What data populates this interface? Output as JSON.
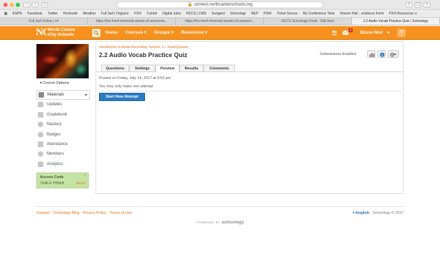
{
  "browser": {
    "url": "connect.northcantonschools.org",
    "bookmarks": [
      "ESPN",
      "Facebook",
      "Twitter",
      "Hootsuite",
      "Weather",
      "Full Sail | Orgsync",
      "FSO",
      "Tumblr",
      "Digital Juice",
      "NCCS | CMS",
      "Sungard",
      "Schoology",
      "MLP",
      "PSW",
      "Ticket Source",
      "My Conference Time",
      "Hoover Hall ...endance Form",
      "FSO-Resources ∨"
    ],
    "tabs": [
      {
        "label": "Full Sail Online | v4",
        "active": false
      },
      {
        "label": "https://fso-lms4-immortal-assets.s3.amazona...",
        "active": false
      },
      {
        "label": "https://fso-lms4-immortal-assets.s3.amazon...",
        "active": false
      },
      {
        "label": "NCCS Schoology Kiosk - Edit Item",
        "active": false
      },
      {
        "label": "2.2 Audio Vocab Practice Quiz | Schoology",
        "active": true
      }
    ]
  },
  "header": {
    "logo_initials": "NC",
    "logo_line1": "North Canton",
    "logo_line2": "City Schools",
    "nav": [
      "Home",
      "Courses ▾",
      "Groups ▾",
      "Resources ▾"
    ],
    "message_count": "1",
    "user_name": "Bruce Nist",
    "help_label": "?"
  },
  "sidebar": {
    "course_options": "▾ Course Options",
    "items": [
      {
        "label": "Materials",
        "icon": "materials-icon"
      },
      {
        "label": "Updates",
        "icon": "updates-icon"
      },
      {
        "label": "Gradebook",
        "icon": "gradebook-icon"
      },
      {
        "label": "Mastery",
        "icon": "mastery-icon"
      },
      {
        "label": "Badges",
        "icon": "badges-icon"
      },
      {
        "label": "Attendance",
        "icon": "attendance-icon"
      },
      {
        "label": "Members",
        "icon": "members-icon"
      },
      {
        "label": "Analytics",
        "icon": "analytics-icon"
      }
    ],
    "access_code": {
      "label": "Access Code",
      "code": "7X4K-F-7HSKH",
      "reset": "Reset",
      "close": "×"
    }
  },
  "main": {
    "breadcrumb": "Introduction to Audio Recording: Section 1 » Tests/Quizzes",
    "title": "2.2 Audio Vocab Practice Quiz",
    "submissions": "Submissions Enabled",
    "tabs": [
      "Questions",
      "Settings",
      "Preview",
      "Results",
      "Comments"
    ],
    "active_tab": "Preview",
    "posted": "Posted on Friday, July 14, 2017 at 9:53 pm",
    "attempts_note": "You may only make one attempt",
    "start_button": "Start New Attempt"
  },
  "footer": {
    "links": [
      "Support",
      "Schoology Blog",
      "Privacy Policy",
      "Terms of Use"
    ],
    "language": "English",
    "copyright": "Schoology © 2017",
    "powered_prefix": "POWERED BY",
    "powered_brand": "schoology"
  },
  "colors": {
    "brand_orange": "#f6911e",
    "link_orange": "#e0701b",
    "button_blue": "#2b7bc4",
    "access_green": "#c6e3a6"
  }
}
